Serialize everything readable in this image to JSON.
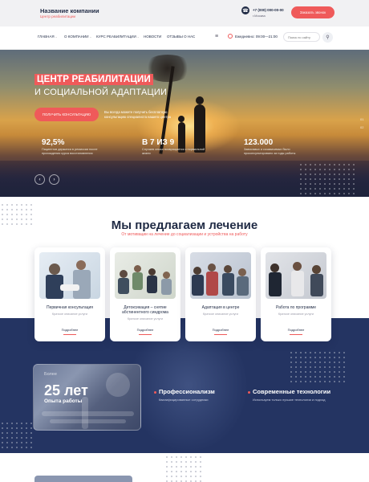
{
  "header": {
    "company_name": "Название компании",
    "company_sub": "Центр реабилитации",
    "phone": "+7 (000) 000-00-00",
    "city": "г.Москва",
    "call_button": "Заказать звонок"
  },
  "nav": {
    "items": [
      {
        "label": "ГЛАВНАЯ",
        "dropdown": true
      },
      {
        "label": "О КОМПАНИИ",
        "dropdown": true
      },
      {
        "label": "КУРС РЕАБИЛИТАЦИИ",
        "dropdown": true
      },
      {
        "label": "НОВОСТИ",
        "dropdown": false
      },
      {
        "label": "ОТЗЫВЫ О НАС",
        "dropdown": false
      }
    ],
    "hours": "Ежедневно: 09:00—21:00",
    "search_placeholder": "Поиск по сайту"
  },
  "hero": {
    "title_line1": "ЦЕНТР РЕАБИЛИТАЦИИ",
    "title_line2": "И СОЦИАЛЬНОЙ АДАПТАЦИИ",
    "button": "ПОЛУЧИТЬ КОНСУЛЬТАЦИЮ",
    "description": "Вы всегда можете получить бесплатную консультацию специалиста нашего центра",
    "stats": [
      {
        "value": "92,5%",
        "label": "Пациентов держатся в ремиссии после прохождения курса восстановления"
      },
      {
        "value": "В 7 ИЗ 9",
        "label": "Случаев семья возвращается к нормальной жизни"
      },
      {
        "value": "123.000",
        "label": "Зависимых и созависимых было проконсультировано за годы работы"
      }
    ],
    "pager": [
      "01",
      "02"
    ],
    "prev_icon": "arrow-left-icon",
    "next_icon": "arrow-right-icon"
  },
  "services": {
    "title": "Мы предлагаем лечение",
    "subtitle": "От мотивации на лечение до социализации и устройства на работу",
    "more_label": "Подробнее",
    "cards": [
      {
        "title": "Первичная консультация",
        "desc": "Краткое описание услуги"
      },
      {
        "title": "Детоксикация – снятие абстинентного синдрома",
        "desc": "Краткое описание услуги"
      },
      {
        "title": "Адаптация в центре",
        "desc": "Краткое описание услуги"
      },
      {
        "title": "Работа по программе",
        "desc": "Краткое описание услуги"
      }
    ]
  },
  "experience": {
    "prefix": "Более",
    "years": "25 лет",
    "label": "Опыта работы"
  },
  "features": [
    {
      "title": "Профессионализм",
      "desc": "Квалифицированные сотрудники"
    },
    {
      "title": "Современные технологии",
      "desc": "Используем только лучшие технологии и подход"
    }
  ],
  "colors": {
    "accent": "#ef5a5a",
    "dark": "#1f2a44",
    "band": "#243462"
  }
}
